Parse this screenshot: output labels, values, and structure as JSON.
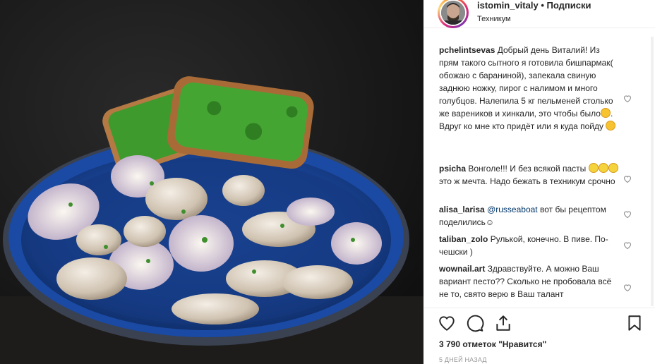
{
  "header": {
    "username": "istomin_vitaly",
    "separator": "•",
    "follow_status": "Подписки",
    "location": "Техникум"
  },
  "comments": [
    {
      "author": "pchelintsevas",
      "text": "Добрый день Виталий! Из прям такого сытного я готовила бишпармак( обожаю с бараниной), запекала свиную заднюю ножку, пирог с налимом и много голубцов. Налепила 5 кг пельменей столько же вареников и хинкали, это чтобы было",
      "text_tail": ". Вдруг ко мне кто придёт или я куда пойду"
    },
    {
      "author": "psicha",
      "text": "Вонголе!!! И без всякой пасты",
      "text_tail": "это ж мечта. Надо бежать в техникум срочно"
    },
    {
      "author": "alisa_larisa",
      "mention": "@russeaboat",
      "text": "вот бы рецептом поделились",
      "text_tail": "☺"
    },
    {
      "author": "taliban_zolo",
      "text": "Рулькой, конечно. В пиве. По-чешски )"
    },
    {
      "author": "wownail.art",
      "text": "Здравствуйте. А можно Ваш вариант песто?? Сколько не пробовала всё не то, свято верю в Ваш талант"
    }
  ],
  "actions": {
    "likes_count": "3 790",
    "likes_text": "отметок \"Нравится\"",
    "timestamp": "5 ДНЕЙ НАЗАД"
  },
  "icons": [
    "heart-icon",
    "comment-icon",
    "share-icon",
    "bookmark-icon"
  ]
}
